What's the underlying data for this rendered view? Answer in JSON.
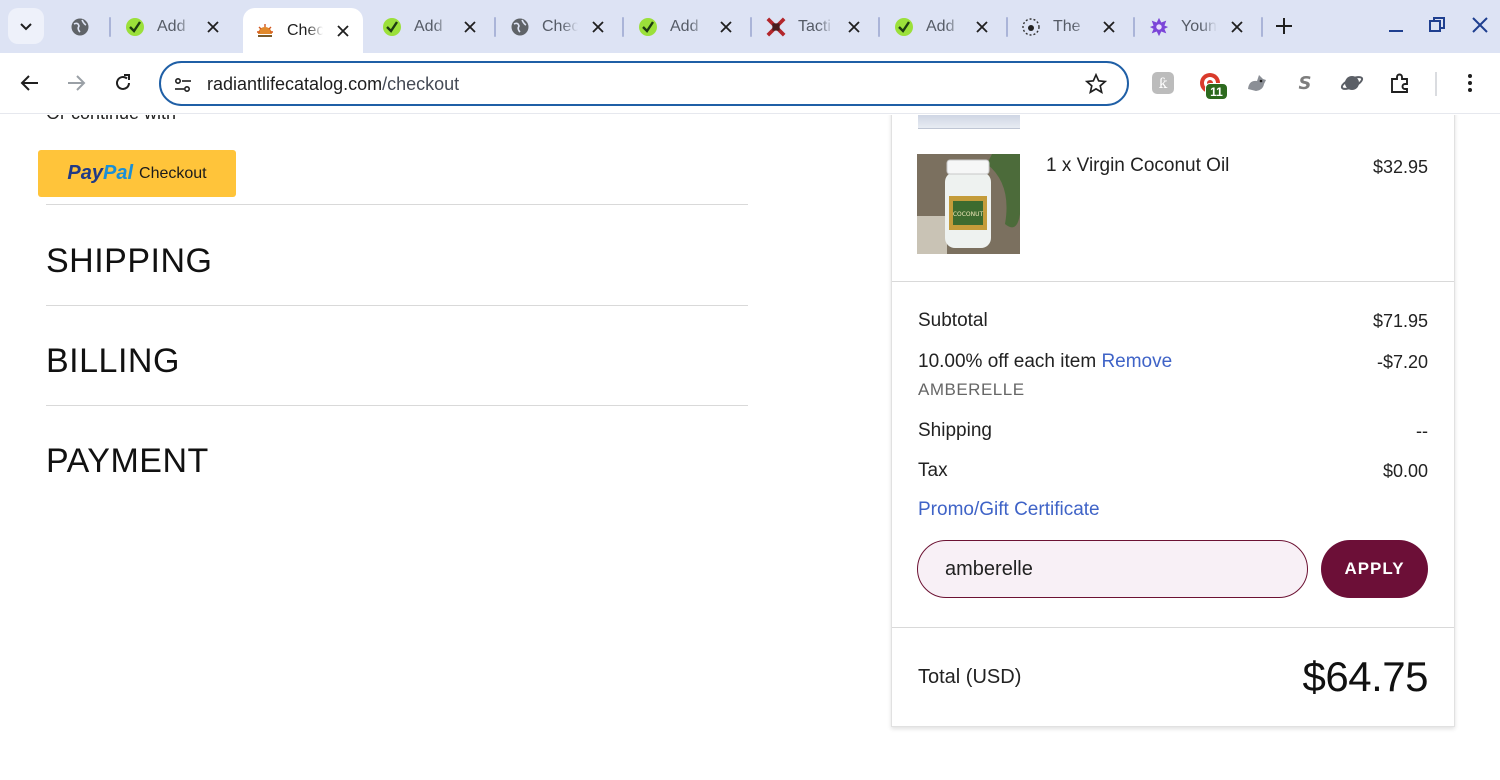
{
  "browser": {
    "tabs": [
      {
        "title": "",
        "icon": "globe-icon"
      },
      {
        "title": "Add",
        "icon": "green-check-icon"
      },
      {
        "title": "Chec",
        "icon": "radiant-life-icon",
        "active": true
      },
      {
        "title": "Add",
        "icon": "green-check-icon"
      },
      {
        "title": "Chec",
        "icon": "globe-icon"
      },
      {
        "title": "Add",
        "icon": "green-check-icon"
      },
      {
        "title": "Tacti",
        "icon": "red-x-icon"
      },
      {
        "title": "Add",
        "icon": "green-check-icon"
      },
      {
        "title": "The",
        "icon": "clock-dot-icon"
      },
      {
        "title": "Youn",
        "icon": "purple-flower-icon"
      }
    ],
    "url": {
      "domain": "radiantlifecatalog.com",
      "path": "/checkout"
    },
    "extension_badge": "11"
  },
  "checkout": {
    "continue_with": "Or continue with",
    "paypal": {
      "brand_pay": "Pay",
      "brand_pal": "Pal",
      "label": "Checkout"
    },
    "sections": {
      "shipping": "SHIPPING",
      "billing": "BILLING",
      "payment": "PAYMENT"
    }
  },
  "summary": {
    "item": {
      "name": "1 x Virgin Coconut Oil",
      "price": "$32.95"
    },
    "subtotal": {
      "label": "Subtotal",
      "value": "$71.95"
    },
    "discount": {
      "label": "10.00% off each item",
      "remove": "Remove",
      "code": "AMBERELLE",
      "value": "-$7.20"
    },
    "shipping": {
      "label": "Shipping",
      "value": "--"
    },
    "tax": {
      "label": "Tax",
      "value": "$0.00"
    },
    "promo": {
      "link": "Promo/Gift Certificate",
      "input_value": "amberelle",
      "apply": "APPLY"
    },
    "total": {
      "label": "Total (USD)",
      "value": "$64.75"
    }
  },
  "colors": {
    "accent_link": "#3f63c7",
    "apply_button": "#6c0f37",
    "paypal_yellow": "#ffc43a",
    "omnibox_border": "#1f5fa6"
  }
}
